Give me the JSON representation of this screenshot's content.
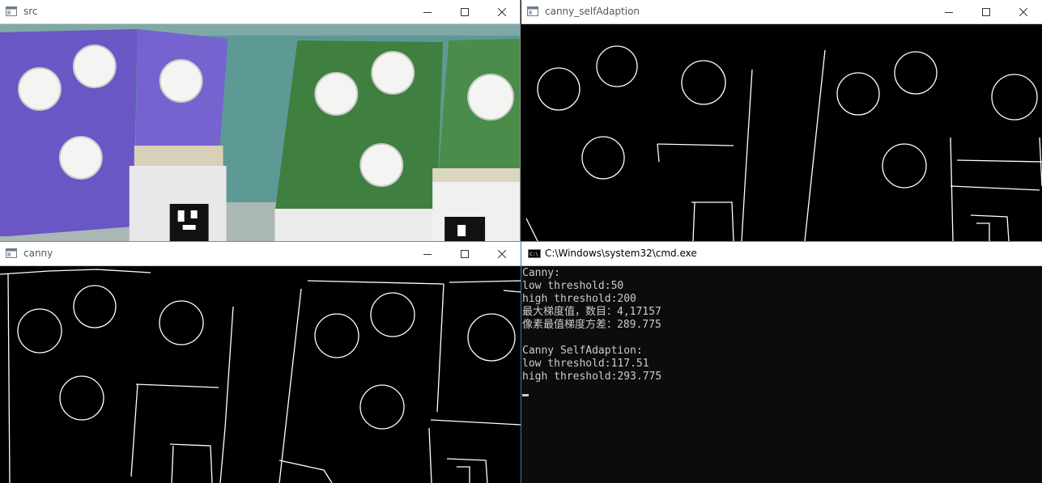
{
  "windows": {
    "src": {
      "title": "src"
    },
    "selfadapt": {
      "title": "canny_selfAdaption"
    },
    "canny": {
      "title": "canny"
    },
    "cmd": {
      "title": "C:\\Windows\\system32\\cmd.exe",
      "icon_label": "C:\\"
    }
  },
  "console": {
    "lines": [
      "Canny:",
      "low threshold:50",
      "high threshold:200",
      "最大梯度值，数目：4,17157",
      "像素最值梯度方差：289.775",
      "",
      "Canny SelfAdaption:",
      "low threshold:117.51",
      "high threshold:293.775"
    ]
  },
  "icons": [
    "app-window-icon",
    "minimize-icon",
    "maximize-icon",
    "close-icon",
    "cmd-console-icon"
  ],
  "colors": {
    "purple_board": "#6a56c4",
    "green_board": "#3f8040",
    "edges": "#ffffff",
    "console_bg": "#0c0c0c",
    "console_text": "#cccccc"
  }
}
